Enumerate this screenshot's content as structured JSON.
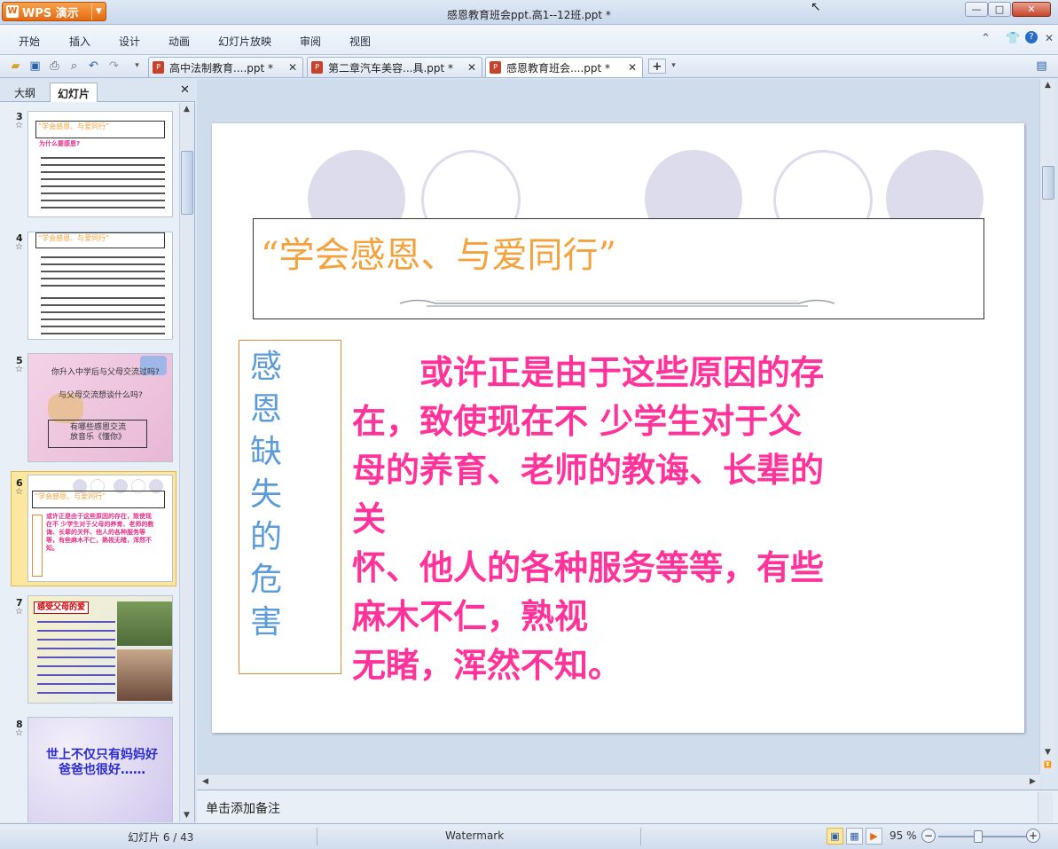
{
  "app": {
    "name": "WPS 演示",
    "window_title": "感恩教育班会ppt.高1--12班.ppt *"
  },
  "menu": [
    "开始",
    "插入",
    "设计",
    "动画",
    "幻灯片放映",
    "审阅",
    "视图"
  ],
  "tabs": [
    {
      "label": "高中法制教育....ppt *",
      "active": false
    },
    {
      "label": "第二章汽车美容...具.ppt *",
      "active": false
    },
    {
      "label": "感恩教育班会....ppt *",
      "active": true
    }
  ],
  "left_pane": {
    "tabs": [
      "大纲",
      "幻灯片"
    ],
    "active_tab": "幻灯片",
    "thumbnails": [
      {
        "num": "3",
        "title": "“学会感恩、与爱同行”",
        "subtitle": "为什么要感恩?"
      },
      {
        "num": "4",
        "title": "“学会感恩、与爱同行”"
      },
      {
        "num": "5",
        "lines": [
          "你升入中学后与父母交流过吗?",
          "与父母交流想谈什么吗?",
          "有哪些感恩交流",
          "放音乐《懂你》"
        ]
      },
      {
        "num": "6",
        "title": "“学会感恩、与爱同行”",
        "body": "或许正是由于这些原因的存在，致使现在不 少学生对于父母的养育、老师的教诲、长辈的关怀、他人的各种服务等等，有些麻木不仁，熟视无睹，浑然不知。",
        "selected": true
      },
      {
        "num": "7",
        "title": "感受父母的爱"
      },
      {
        "num": "8",
        "lines": [
          "世上不仅只有妈妈好",
          "爸爸也很好……"
        ]
      }
    ]
  },
  "slide": {
    "title": "“学会感恩、与爱同行”",
    "side_label": "感恩缺失的危害",
    "body_lines": [
      "　　或许正是由于这些原因的存",
      "在，致使现在不 少学生对于父",
      "母的养育、老师的教诲、长辈的",
      "关",
      "怀、他人的各种服务等等，有些",
      "麻木不仁，熟视",
      "无睹，浑然不知。"
    ]
  },
  "notes_placeholder": "单击添加备注",
  "status": {
    "slide_counter": "幻灯片 6 / 43",
    "theme": "Watermark",
    "zoom": "95 %"
  },
  "colors": {
    "title_orange": "#f4a23c",
    "body_pink": "#ff3399",
    "side_blue": "#5b9bd8",
    "accent": "#e46a12"
  }
}
